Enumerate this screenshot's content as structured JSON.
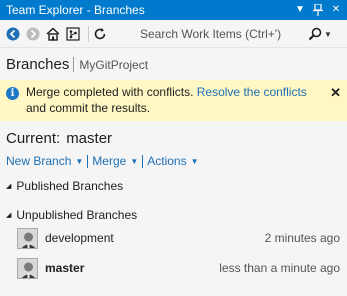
{
  "window": {
    "title": "Team Explorer - Branches",
    "icons": [
      "dropdown-icon",
      "pin-icon",
      "close-icon"
    ]
  },
  "toolbar": {
    "buttons": [
      "back-icon",
      "forward-icon",
      "home-icon",
      "git-icon",
      "refresh-icon"
    ],
    "search_placeholder": "Search Work Items (Ctrl+')"
  },
  "header": {
    "title": "Branches",
    "project": "MyGitProject"
  },
  "notification": {
    "message_before": "Merge completed with conflicts. ",
    "link": "Resolve the conflicts",
    "message_after": "and commit the results."
  },
  "current": {
    "label": "Current:",
    "branch": "master"
  },
  "actions": {
    "new_branch": "New Branch",
    "merge": "Merge",
    "actions": "Actions"
  },
  "sections": {
    "published": "Published Branches",
    "unpublished": "Unpublished Branches"
  },
  "branches": [
    {
      "name": "development",
      "time": "2 minutes ago",
      "current": false
    },
    {
      "name": "master",
      "time": "less than a minute ago",
      "current": true
    }
  ],
  "colors": {
    "accent": "#007acc",
    "link": "#1e6fb5",
    "notice_bg": "#fff8c4"
  }
}
